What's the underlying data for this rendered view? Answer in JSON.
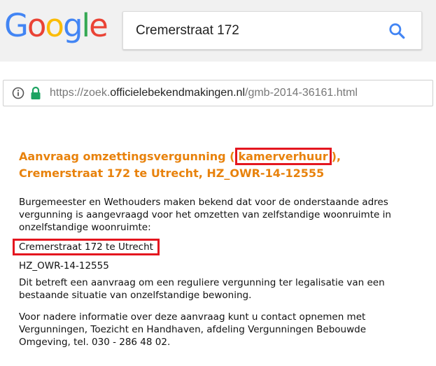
{
  "search": {
    "query": "Cremerstraat 172"
  },
  "logo": {
    "letters": [
      "G",
      "o",
      "o",
      "g",
      "l",
      "e"
    ],
    "colors": [
      "#4285f4",
      "#ea4335",
      "#fbbc05",
      "#4285f4",
      "#34a853",
      "#ea4335"
    ]
  },
  "url_bar": {
    "prefix": "https://zoek.",
    "domain": "officielebekendmakingen.nl",
    "path": "/gmb-2014-36161.html",
    "lock_color": "#1ea362"
  },
  "article": {
    "title_line1_before": "Aanvraag omzettingsvergunning (",
    "title_highlight": "kamerverhuur",
    "title_line1_after": "),",
    "title_line2": "Cremerstraat 172 te Utrecht, HZ_OWR-14-12555",
    "intro": "Burgemeester en Wethouders maken bekend dat voor de onderstaande adres vergunning is aangevraagd voor het omzetten van zelfstandige woonruimte in onzelfstandige woonruimte:",
    "address": "Cremerstraat 172 te Utrecht",
    "case_number": "HZ_OWR-14-12555",
    "description": "Dit betreft een aanvraag om een reguliere vergunning ter legalisatie van een bestaande situatie van onzelfstandige bewoning.",
    "contact": "Voor nadere informatie over deze aanvraag kunt u contact opnemen met Vergunningen, Toezicht en Handhaven, afdeling Vergunningen Bebouwde Omgeving, tel. 030 - 286 48 02."
  },
  "colors": {
    "title": "#e8820c",
    "highlight_box": "#e4161f"
  }
}
